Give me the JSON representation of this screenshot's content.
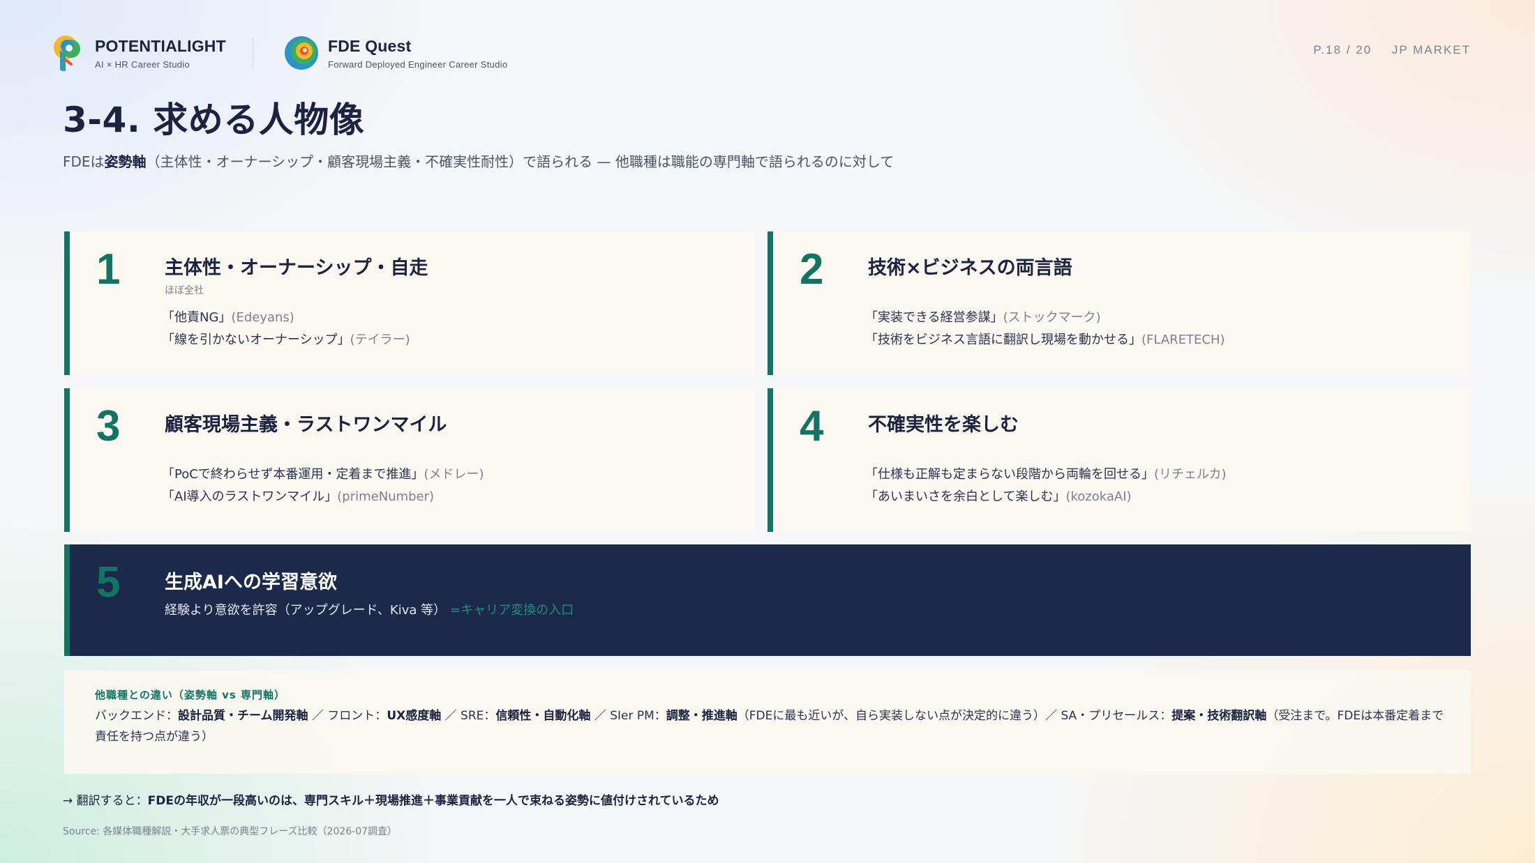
{
  "header": {
    "brand1": {
      "name": "POTENTIALIGHT",
      "sub": "AI × HR Career Studio"
    },
    "brand2": {
      "name": "FDE Quest",
      "sub": "Forward Deployed Engineer Career Studio"
    },
    "page": "P.18 / 20",
    "market": "JP MARKET"
  },
  "title": "3-4. 求める人物像",
  "subtitle": {
    "pre": "FDEは",
    "bold": "姿勢軸",
    "post": "（主体性・オーナーシップ・顧客現場主義・不確実性耐性）で語られる — 他職種は職能の専門軸で語られるのに対して"
  },
  "cards": [
    {
      "num": "1",
      "heading": "主体性・オーナーシップ・自走",
      "note": "ほぼ全社",
      "quotes": [
        {
          "text": "「他責NG」",
          "src": "(Edeyans)"
        },
        {
          "text": "「線を引かないオーナーシップ」",
          "src": "(テイラー)"
        }
      ]
    },
    {
      "num": "2",
      "heading": "技術×ビジネスの両言語",
      "note": "",
      "quotes": [
        {
          "text": "「実装できる経営参謀」",
          "src": "(ストックマーク)"
        },
        {
          "text": "「技術をビジネス言語に翻訳し現場を動かせる」",
          "src": "(FLARETECH)"
        }
      ]
    },
    {
      "num": "3",
      "heading": "顧客現場主義・ラストワンマイル",
      "note": "",
      "quotes": [
        {
          "text": "「PoCで終わらせず本番運用・定着まで推進」",
          "src": "(メドレー)"
        },
        {
          "text": "「AI導入のラストワンマイル」",
          "src": "(primeNumber)"
        }
      ]
    },
    {
      "num": "4",
      "heading": "不確実性を楽しむ",
      "note": "",
      "quotes": [
        {
          "text": "「仕様も正解も定まらない段階から両輪を回せる」",
          "src": "(リチェルカ)"
        },
        {
          "text": "「あいまいさを余白として楽しむ」",
          "src": "(kozokaAI)"
        }
      ]
    }
  ],
  "card5": {
    "num": "5",
    "heading": "生成AIへの学習意欲",
    "desc": "経験より意欲を許容（アップグレード、Kiva 等）",
    "accent": "=キャリア変換の入口"
  },
  "diff": {
    "label": "他職種との違い（姿勢軸 vs 専門軸）",
    "t1": "バックエンド：",
    "b1": "設計品質・チーム開発軸",
    "t2": " ／ フロント：",
    "b2": "UX感度軸",
    "t3": " ／ SRE：",
    "b3": "信頼性・自動化軸",
    "t4": " ／ SIer PM：",
    "b4": "調整・推進軸",
    "t5": "（FDEに最も近いが、自ら実装しない点が決定的に違う）／ SA・プリセールス：",
    "b5": "提案・技術翻訳軸",
    "t6": "（受注まで。FDEは本番定着まで責任を持つ点が違う）"
  },
  "conclusion": {
    "pre": "→ 翻訳すると：",
    "bold": "FDEの年収が一段高いのは、専門スキル＋現場推進＋事業貢献を一人で束ねる姿勢に値付けされているため"
  },
  "source": "Source: 各媒体職種解説・大手求人票の典型フレーズ比較（2026-07調査）",
  "colors": {
    "accent": "#127563",
    "navy": "#1b2a4a",
    "card_bg": "#faf8f0",
    "accent_light": "#1e8f7a"
  }
}
